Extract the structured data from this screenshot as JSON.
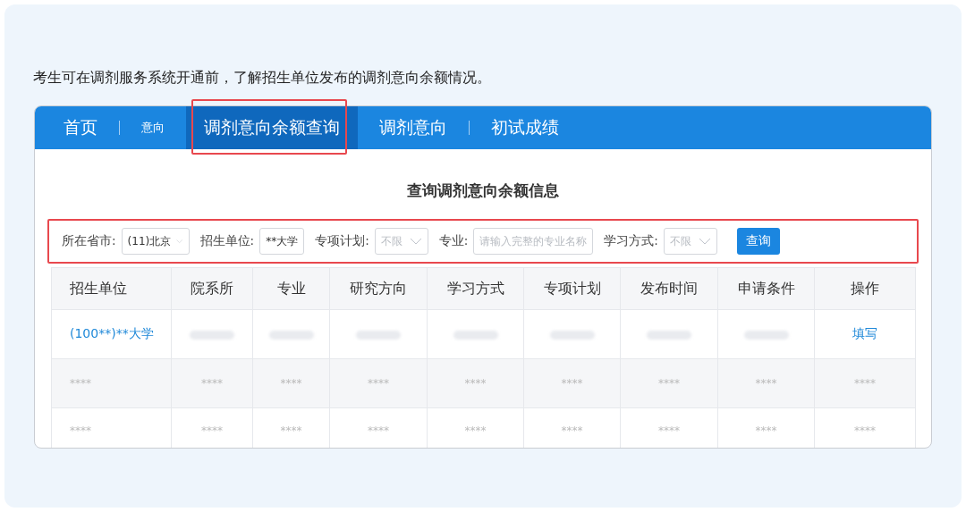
{
  "caption": "考生可在调剂服务系统开通前，了解招生单位发布的调剂意向余额情况。",
  "nav": {
    "items": [
      {
        "label": "首页",
        "kind": "main",
        "selected": false,
        "highlighted": false
      },
      {
        "label": "意向",
        "kind": "small",
        "selected": false,
        "highlighted": false
      },
      {
        "label": "调剂意向余额查询",
        "kind": "main",
        "selected": true,
        "highlighted": true
      },
      {
        "label": "调剂意向",
        "kind": "main",
        "selected": false,
        "highlighted": false
      },
      {
        "label": "初试成绩",
        "kind": "main",
        "selected": false,
        "highlighted": false
      }
    ]
  },
  "page_title": "查询调剂意向余额信息",
  "filters": {
    "highlighted": true,
    "fields": [
      {
        "kind": "select",
        "label": "所在省市:",
        "value": "(11)北京"
      },
      {
        "kind": "input",
        "label": "招生单位:",
        "value": "**大学"
      },
      {
        "kind": "select",
        "label": "专项计划:",
        "placeholder": "不限"
      },
      {
        "kind": "input",
        "label": "专业:",
        "placeholder": "请输入完整的专业名称"
      },
      {
        "kind": "select",
        "label": "学习方式:",
        "placeholder": "不限"
      }
    ],
    "button": "查询"
  },
  "table": {
    "columns": [
      "招生单位",
      "院系所",
      "专业",
      "研究方向",
      "学习方式",
      "专项计划",
      "发布时间",
      "申请条件",
      "操作"
    ],
    "rows": [
      [
        {
          "kind": "link",
          "text": "(100**)**大学"
        },
        {
          "kind": "blurred"
        },
        {
          "kind": "blurred"
        },
        {
          "kind": "blurred"
        },
        {
          "kind": "blurred"
        },
        {
          "kind": "blurred"
        },
        {
          "kind": "blurred"
        },
        {
          "kind": "blurred"
        },
        {
          "kind": "link",
          "text": "填写"
        }
      ],
      [
        {
          "kind": "masked",
          "text": "****"
        },
        {
          "kind": "masked",
          "text": "****"
        },
        {
          "kind": "masked",
          "text": "****"
        },
        {
          "kind": "masked",
          "text": "****"
        },
        {
          "kind": "masked",
          "text": "****"
        },
        {
          "kind": "masked",
          "text": "****"
        },
        {
          "kind": "masked",
          "text": "****"
        },
        {
          "kind": "masked",
          "text": "****"
        },
        {
          "kind": "masked",
          "text": "****"
        }
      ],
      [
        {
          "kind": "masked",
          "text": "****"
        },
        {
          "kind": "masked",
          "text": "****"
        },
        {
          "kind": "masked",
          "text": "****"
        },
        {
          "kind": "masked",
          "text": "****"
        },
        {
          "kind": "masked",
          "text": "****"
        },
        {
          "kind": "masked",
          "text": "****"
        },
        {
          "kind": "masked",
          "text": "****"
        },
        {
          "kind": "masked",
          "text": "****"
        },
        {
          "kind": "masked",
          "text": "****"
        }
      ]
    ]
  }
}
